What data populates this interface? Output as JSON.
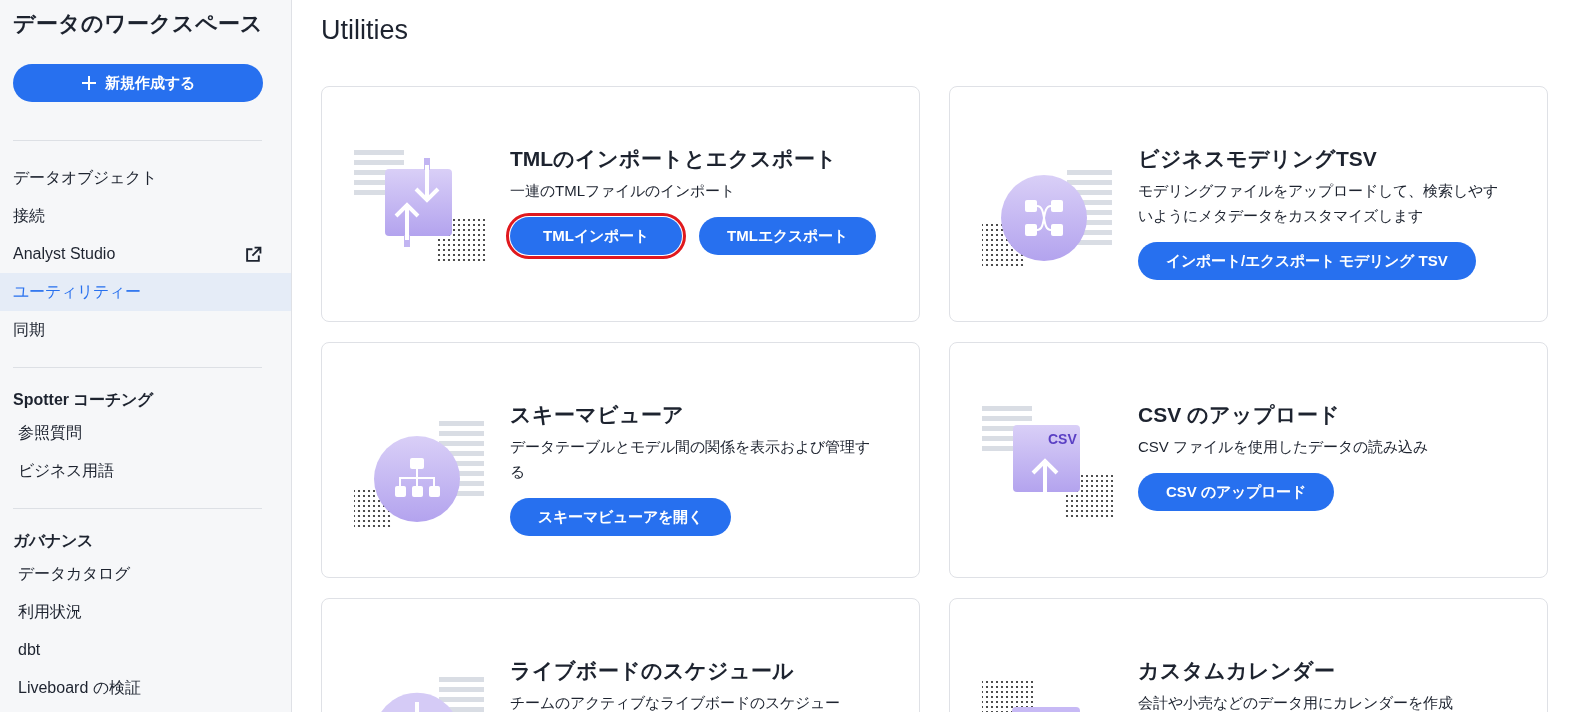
{
  "sidebar": {
    "title": "データのワークスペース",
    "new_button": {
      "label": "新規作成する"
    },
    "sections": [
      {
        "items": [
          {
            "label": "データオブジェクト",
            "selected": false,
            "external": false
          },
          {
            "label": "接続",
            "selected": false,
            "external": false
          },
          {
            "label": "Analyst Studio",
            "selected": false,
            "external": true
          },
          {
            "label": "ユーティリティー",
            "selected": true,
            "external": false
          },
          {
            "label": "同期",
            "selected": false,
            "external": false
          }
        ]
      },
      {
        "heading": "Spotter コーチング",
        "items": [
          {
            "label": "参照質問",
            "selected": false,
            "external": false
          },
          {
            "label": "ビジネス用語",
            "selected": false,
            "external": false
          }
        ]
      },
      {
        "heading": "ガバナンス",
        "items": [
          {
            "label": "データカタログ",
            "selected": false,
            "external": false
          },
          {
            "label": "利用状況",
            "selected": false,
            "external": false
          },
          {
            "label": "dbt",
            "selected": false,
            "external": false
          },
          {
            "label": "Liveboard の検証",
            "selected": false,
            "external": false
          }
        ]
      }
    ]
  },
  "main": {
    "title": "Utilities",
    "cards": [
      {
        "kind": "tml",
        "title": "TMLのインポートとエクスポート",
        "description": "一連のTMLファイルのインポート",
        "buttons": [
          {
            "label": "TMLインポート",
            "highlighted": true
          },
          {
            "label": "TMLエクスポート",
            "highlighted": false
          }
        ]
      },
      {
        "kind": "model",
        "title": "ビジネスモデリングTSV",
        "description": "モデリングファイルをアップロードして、検索しやすいようにメタデータをカスタマイズします",
        "buttons": [
          {
            "label": "インポート/エクスポート モデリング TSV",
            "highlighted": false
          }
        ]
      },
      {
        "kind": "schema",
        "title": "スキーマビューア",
        "description": "データテーブルとモデル間の関係を表示および管理する",
        "buttons": [
          {
            "label": "スキーマビューアを開く",
            "highlighted": false
          }
        ]
      },
      {
        "kind": "csv",
        "badge": "CSV",
        "title": "CSV のアップロード",
        "description": "CSV ファイルを使用したデータの読み込み",
        "buttons": [
          {
            "label": "CSV のアップロード",
            "highlighted": false
          }
        ]
      },
      {
        "kind": "schedule",
        "title": "ライブボードのスケジュール",
        "description": "チームのアクティブなライブボードのスケジュー"
      },
      {
        "kind": "calendar",
        "title": "カスタムカレンダー",
        "description": "会計や小売などのデータ用にカレンダーを作成"
      }
    ]
  }
}
